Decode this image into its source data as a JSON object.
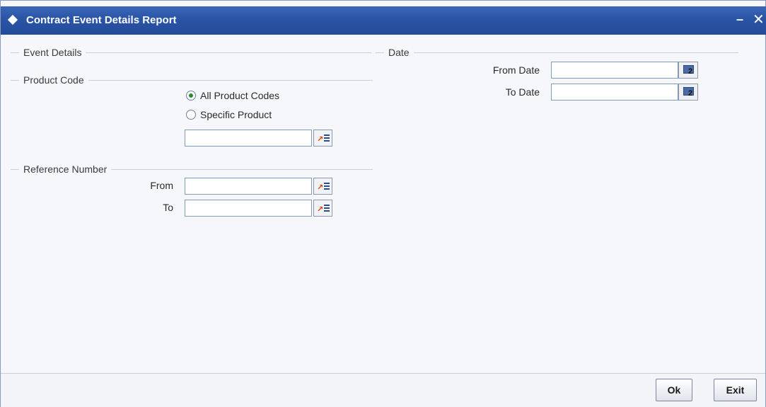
{
  "window": {
    "title": "Contract Event Details Report",
    "minimize_glyph": "–",
    "close_glyph": "✕"
  },
  "event_details": {
    "legend": "Event Details",
    "product_code": {
      "legend": "Product Code",
      "options": [
        {
          "label": "All Product Codes",
          "checked": true
        },
        {
          "label": "Specific Product",
          "checked": false
        }
      ],
      "specific_product_value": ""
    },
    "reference_number": {
      "legend": "Reference Number",
      "from_label": "From",
      "to_label": "To",
      "from_value": "",
      "to_value": ""
    }
  },
  "date": {
    "legend": "Date",
    "from_label": "From Date",
    "to_label": "To Date",
    "from_value": "",
    "to_value": "",
    "calendar_day": "2"
  },
  "footer": {
    "ok_label": "Ok",
    "exit_label": "Exit"
  },
  "icons": {
    "lov": "list-of-values-icon",
    "calendar": "calendar-icon"
  },
  "colors": {
    "titlebar": "#2a54a6",
    "background": "#f6f7fa",
    "radio_checked": "#2f8a2f"
  }
}
